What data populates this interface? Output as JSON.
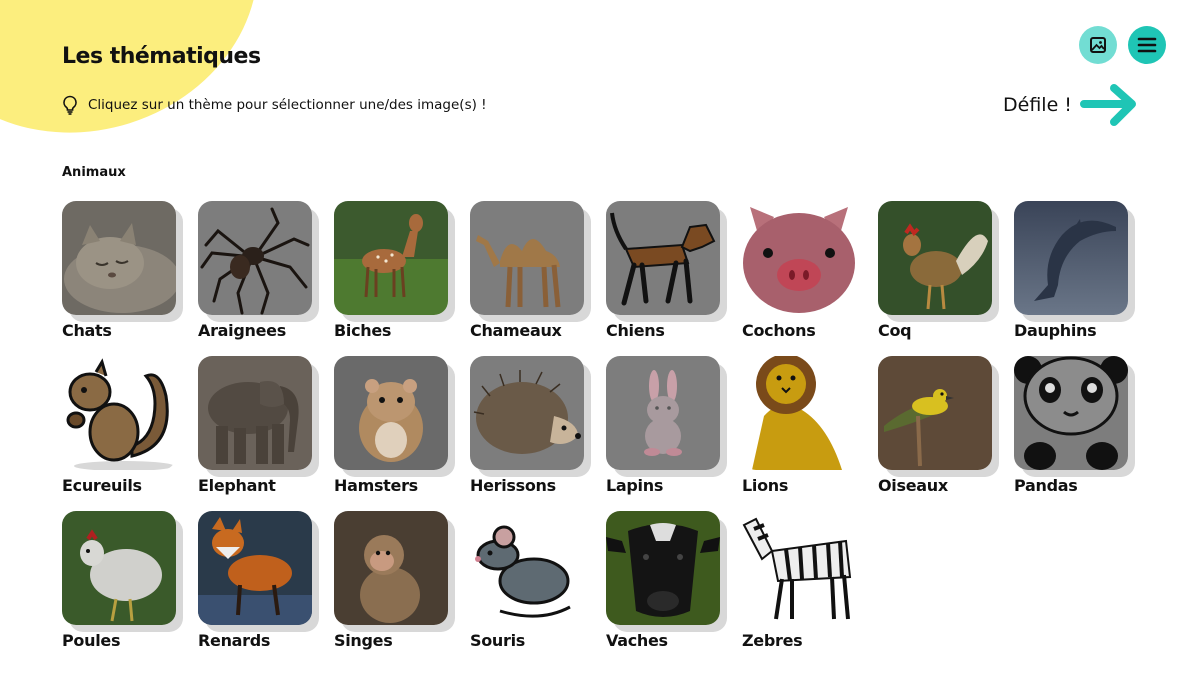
{
  "header": {
    "title": "Les thématiques",
    "hint": "Cliquez sur un thème pour sélectionner une/des image(s) !",
    "scroll_hint": "Défile !"
  },
  "toolbar": {
    "image_icon": "image-icon",
    "menu_icon": "hamburger-menu-icon"
  },
  "colors": {
    "accent": "#1fc5b5",
    "accent_light": "#72ddd3",
    "blob": "#fcee7e"
  },
  "section": {
    "label": "Animaux",
    "items": [
      {
        "label": "Chats"
      },
      {
        "label": "Araignees"
      },
      {
        "label": "Biches"
      },
      {
        "label": "Chameaux"
      },
      {
        "label": "Chiens"
      },
      {
        "label": "Cochons"
      },
      {
        "label": "Coq"
      },
      {
        "label": "Dauphins"
      },
      {
        "label": "Ecureuils"
      },
      {
        "label": "Elephant"
      },
      {
        "label": "Hamsters"
      },
      {
        "label": "Herissons"
      },
      {
        "label": "Lapins"
      },
      {
        "label": "Lions"
      },
      {
        "label": "Oiseaux"
      },
      {
        "label": "Pandas"
      },
      {
        "label": "Poules"
      },
      {
        "label": "Renards"
      },
      {
        "label": "Singes"
      },
      {
        "label": "Souris"
      },
      {
        "label": "Vaches"
      },
      {
        "label": "Zebres"
      }
    ]
  }
}
